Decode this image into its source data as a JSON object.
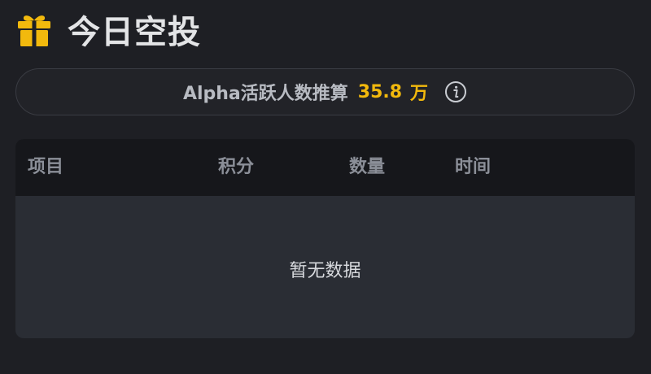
{
  "header": {
    "icon": "gift-icon",
    "title": "今日空投",
    "icon_color": "#f2b90d"
  },
  "stats": {
    "label": "Alpha活跃人数推算",
    "value": "35.8",
    "unit": "万",
    "info_icon": "info-icon",
    "value_color": "#f2b90d"
  },
  "table": {
    "columns": [
      "项目",
      "积分",
      "数量",
      "时间"
    ],
    "rows": [],
    "empty_text": "暂无数据"
  }
}
